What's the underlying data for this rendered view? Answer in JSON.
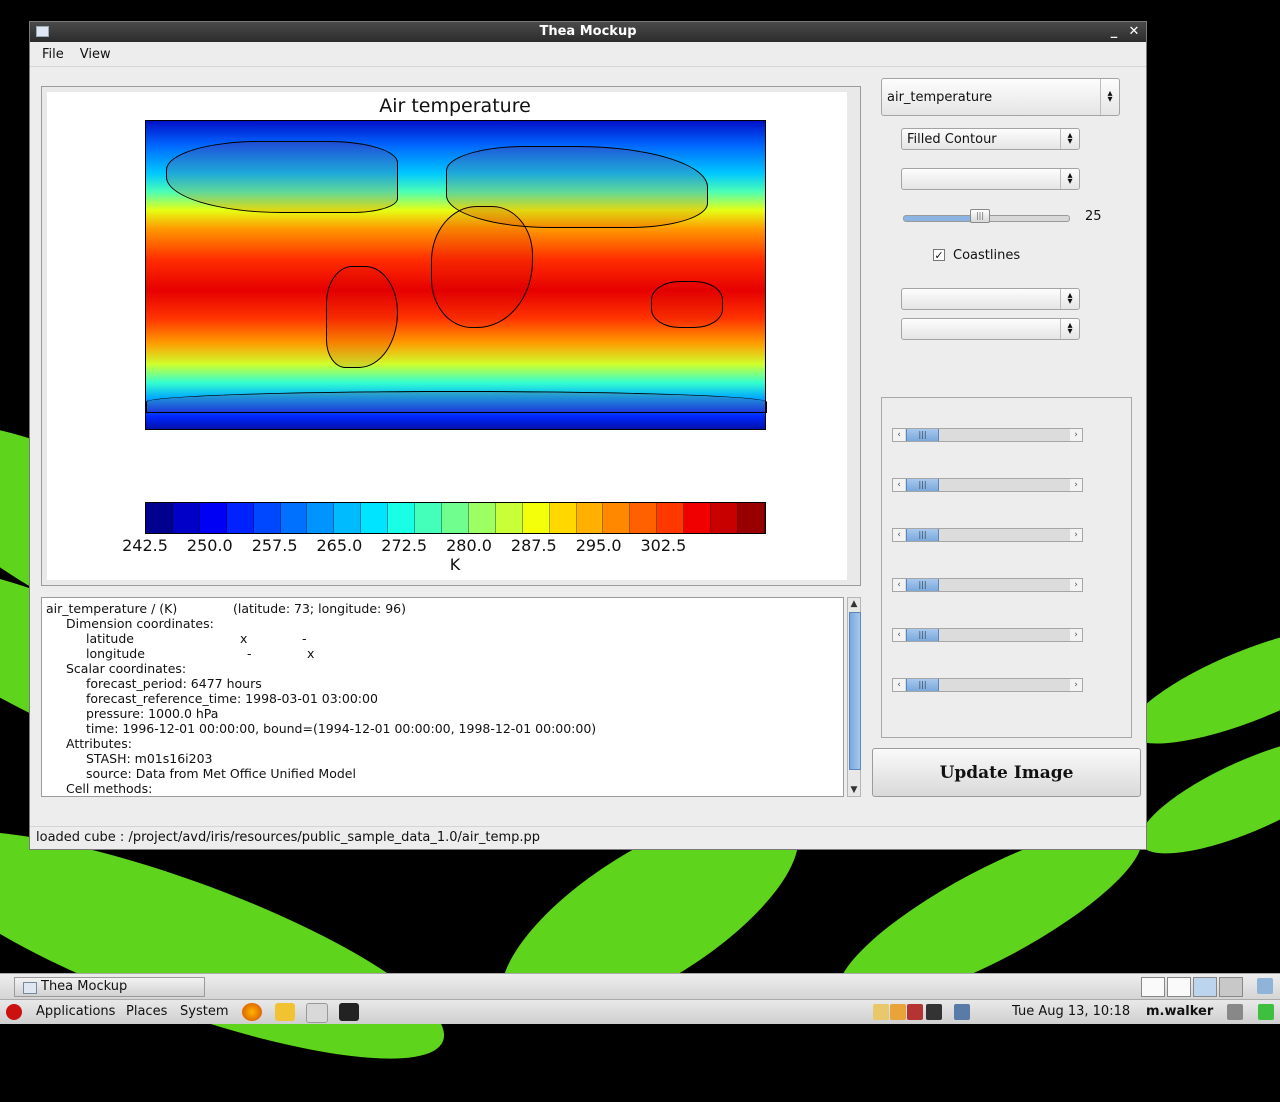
{
  "window": {
    "title": "Thea Mockup",
    "minimize_glyph": "_",
    "close_glyph": "✕"
  },
  "menubar": {
    "file": "File",
    "view": "View"
  },
  "plot": {
    "title": "Air temperature",
    "colorbar_ticks": [
      "242.5",
      "250.0",
      "257.5",
      "265.0",
      "272.5",
      "280.0",
      "287.5",
      "295.0",
      "302.5"
    ],
    "colorbar_unit": "K",
    "colorbar_colors": [
      "#00008f",
      "#0000c8",
      "#0000f5",
      "#0022ff",
      "#0048ff",
      "#0070ff",
      "#0094ff",
      "#00bcff",
      "#00e4ff",
      "#18ffe6",
      "#44ffba",
      "#70ff8e",
      "#9cff62",
      "#c8ff36",
      "#f4ff0a",
      "#ffd800",
      "#ffb000",
      "#ff8800",
      "#ff6000",
      "#ff3800",
      "#f00000",
      "#c80000",
      "#980000"
    ]
  },
  "cube_info": {
    "header": "air_temperature / (K)",
    "shape": "(latitude: 73; longitude: 96)",
    "dim_coords_label": "Dimension coordinates:",
    "dim_coords": [
      {
        "name": "latitude",
        "col1": "x",
        "col2": "-"
      },
      {
        "name": "longitude",
        "col1": "-",
        "col2": "x"
      }
    ],
    "scalar_coords_label": "Scalar coordinates:",
    "scalar_coords": [
      "forecast_period: 6477 hours",
      "forecast_reference_time: 1998-03-01 03:00:00",
      "pressure: 1000.0 hPa",
      "time: 1996-12-01 00:00:00, bound=(1994-12-01 00:00:00, 1998-12-01 00:00:00)"
    ],
    "attributes_label": "Attributes:",
    "attributes": [
      "STASH: m01s16i203",
      "source: Data from Met Office Unified Model"
    ],
    "cell_methods_label": "Cell methods:"
  },
  "controls": {
    "cube_select": "air_temperature",
    "plot_type_select": "Filled Contour",
    "cmap_select": "",
    "levels_value": "25",
    "levels_fraction": 0.46,
    "coastlines_label": "Coastlines",
    "coastlines_checked": true,
    "x_axis_select": "",
    "y_axis_select": "",
    "update_button": "Update Image"
  },
  "status": {
    "text": "loaded cube : /project/avd/iris/resources/public_sample_data_1.0/air_temp.pp"
  },
  "taskbar": {
    "window_button": "Thea Mockup",
    "applications": "Applications",
    "places": "Places",
    "system": "System",
    "clock": "Tue Aug 13, 10:18",
    "user": "m.walker"
  }
}
